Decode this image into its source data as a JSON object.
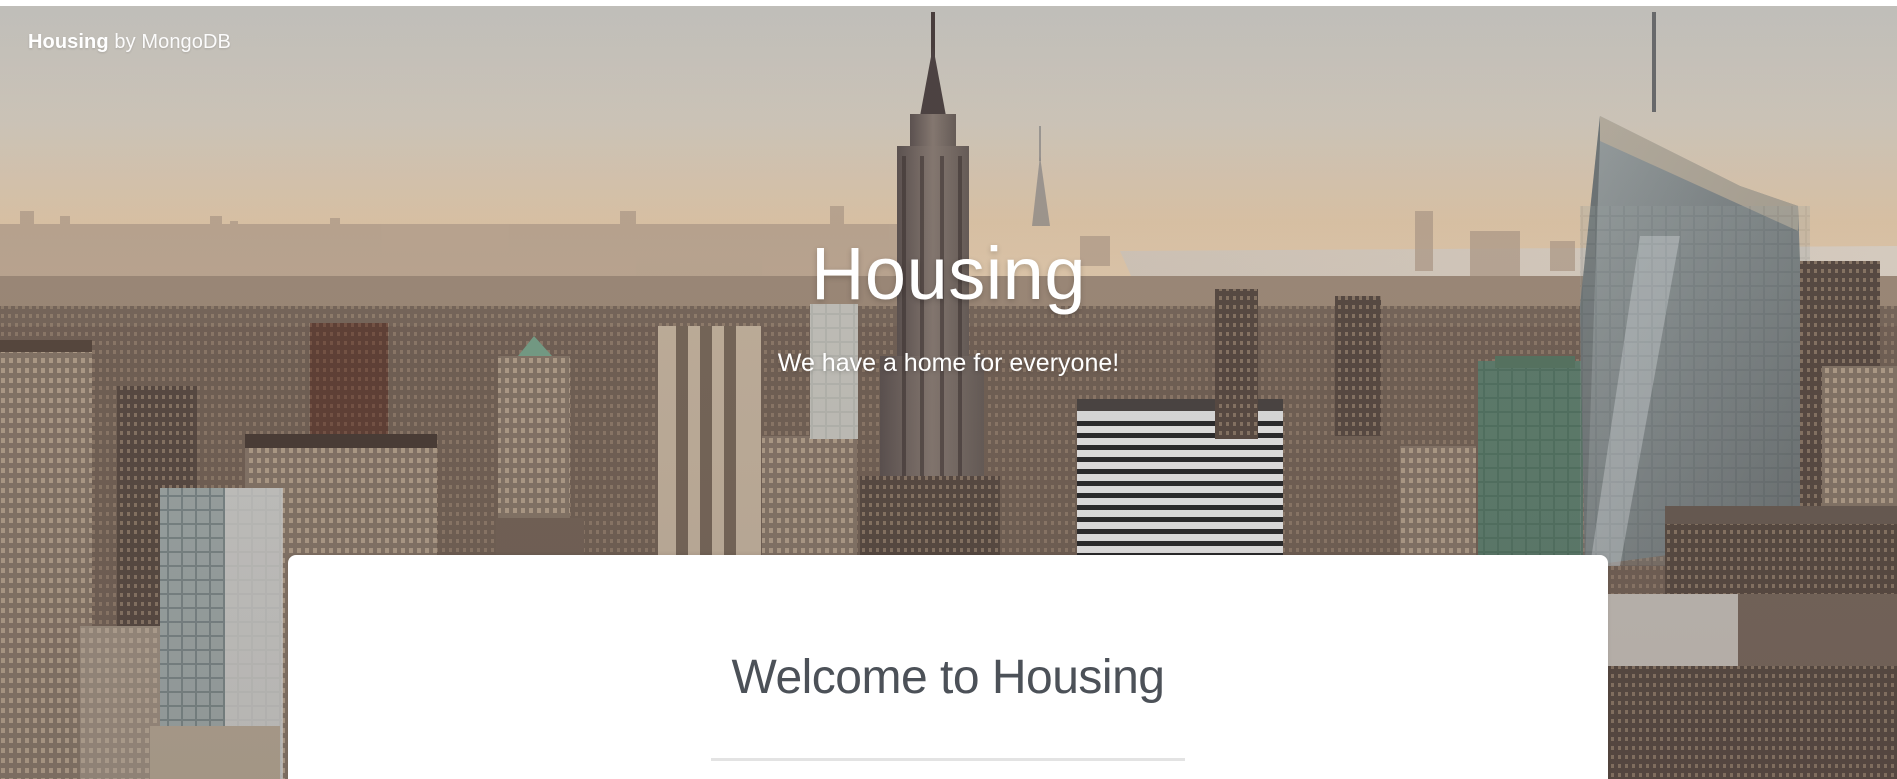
{
  "header": {
    "brand_name": "Housing",
    "brand_suffix": "by MongoDB"
  },
  "hero": {
    "title": "Housing",
    "subtitle": "We have a home for everyone!",
    "background": "city-skyline-image"
  },
  "welcome": {
    "title": "Welcome to Housing"
  },
  "colors": {
    "hero_text": "#ffffff",
    "card_background": "#ffffff",
    "card_title": "#4c5158",
    "divider": "#e3e3e3"
  }
}
